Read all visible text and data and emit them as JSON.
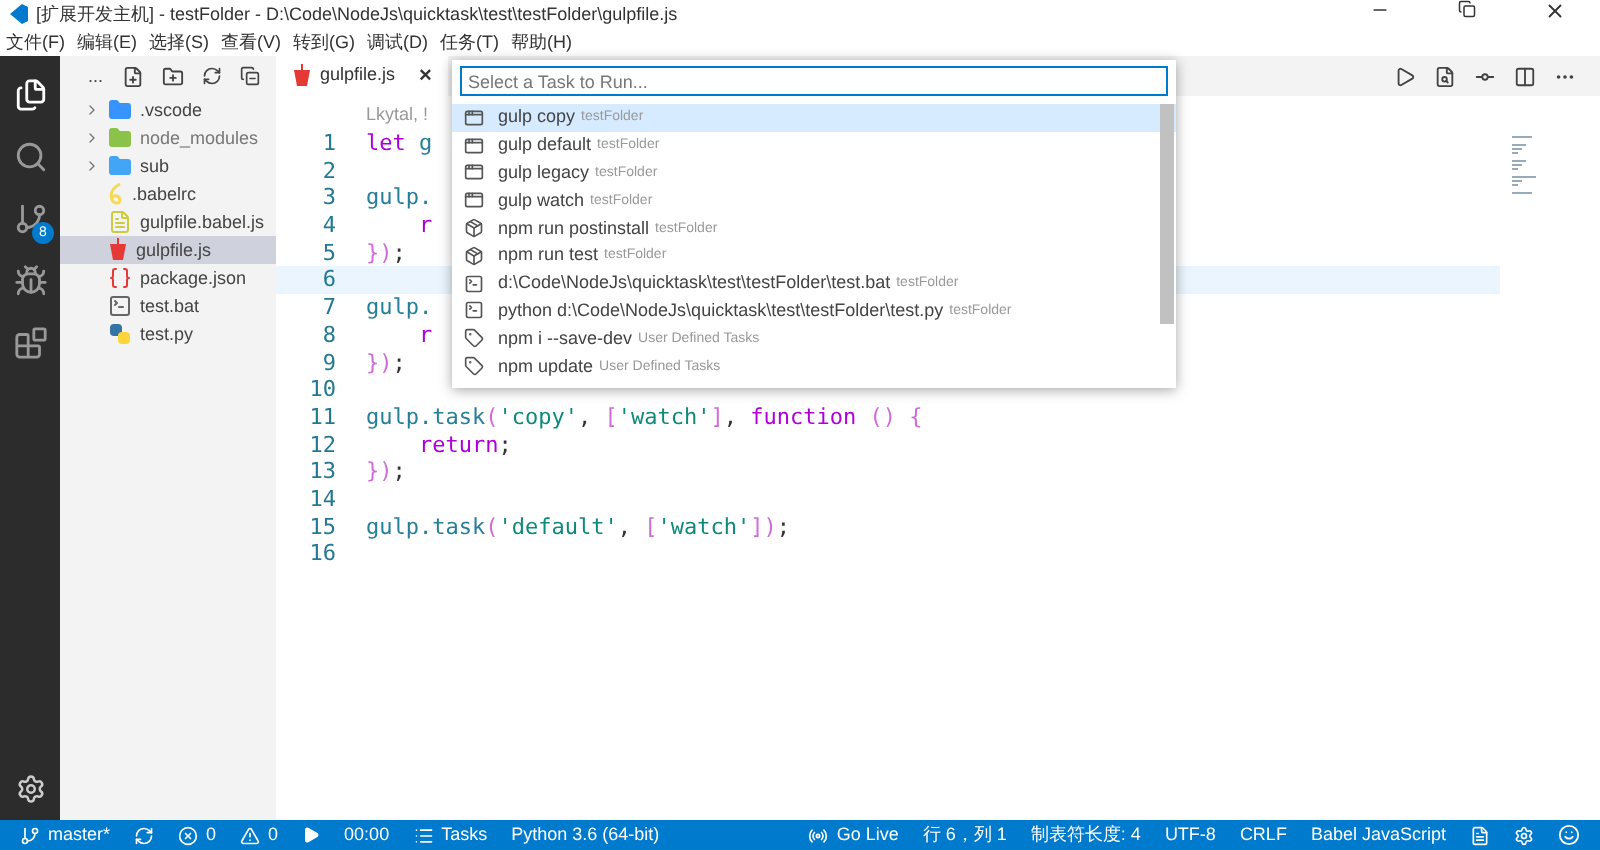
{
  "window": {
    "title": "[扩展开发主机] - testFolder - D:\\Code\\NodeJs\\quicktask\\test\\testFolder\\gulpfile.js"
  },
  "menu": [
    "文件(F)",
    "编辑(E)",
    "选择(S)",
    "查看(V)",
    "转到(G)",
    "调试(D)",
    "任务(T)",
    "帮助(H)"
  ],
  "activity_bar": [
    {
      "kind": "files",
      "selected": true
    },
    {
      "kind": "search",
      "selected": false
    },
    {
      "kind": "scm",
      "selected": false,
      "badge": "8"
    },
    {
      "kind": "debug",
      "selected": false
    },
    {
      "kind": "extensions",
      "selected": false
    }
  ],
  "explorer": {
    "more": "...",
    "items": [
      {
        "name": ".vscode",
        "kind": "folder-vscode",
        "expanded": false,
        "selected": false
      },
      {
        "name": "node_modules",
        "kind": "folder-node",
        "expanded": false,
        "selected": false
      },
      {
        "name": "sub",
        "kind": "folder",
        "expanded": false,
        "selected": false
      },
      {
        "name": ".babelrc",
        "kind": "babel",
        "selected": false
      },
      {
        "name": "gulpfile.babel.js",
        "kind": "js",
        "selected": false
      },
      {
        "name": "gulpfile.js",
        "kind": "gulp",
        "selected": true
      },
      {
        "name": "package.json",
        "kind": "json",
        "selected": false
      },
      {
        "name": "test.bat",
        "kind": "bat",
        "selected": false
      },
      {
        "name": "test.py",
        "kind": "py",
        "selected": false
      }
    ]
  },
  "tabs": [
    {
      "label": "gulpfile.js",
      "selected": true,
      "close": "×"
    }
  ],
  "editor": {
    "codelens": "Lkytal, !",
    "lines": [
      {
        "number": "1",
        "current": false,
        "tokens": [
          {
            "text": "let",
            "kind": "keyword"
          },
          {
            "text": " g",
            "kind": "plain"
          }
        ]
      },
      {
        "number": "2",
        "current": false
      },
      {
        "number": "3",
        "current": false,
        "tokens": [
          {
            "text": "gulp.",
            "kind": "plain"
          }
        ]
      },
      {
        "number": "4",
        "current": false,
        "tokens": [
          {
            "text": "    r",
            "kind": "keyword"
          }
        ]
      },
      {
        "number": "5",
        "current": false,
        "tokens": [
          {
            "text": "})",
            "kind": "bracket"
          },
          {
            "text": ";",
            "kind": "punct"
          }
        ]
      },
      {
        "number": "6",
        "current": true
      },
      {
        "number": "7",
        "current": false,
        "tokens": [
          {
            "text": "gulp.",
            "kind": "plain"
          }
        ]
      },
      {
        "number": "8",
        "current": false,
        "tokens": [
          {
            "text": "    r",
            "kind": "keyword"
          }
        ]
      },
      {
        "number": "9",
        "current": false,
        "tokens": [
          {
            "text": "})",
            "kind": "bracket"
          },
          {
            "text": ";",
            "kind": "punct"
          }
        ]
      },
      {
        "number": "10",
        "current": false
      },
      {
        "number": "11",
        "current": false,
        "tokens": [
          {
            "text": "gulp.",
            "kind": "plain"
          },
          {
            "text": "task",
            "kind": "func"
          },
          {
            "text": "(",
            "kind": "bracket"
          },
          {
            "text": "'copy'",
            "kind": "string"
          },
          {
            "text": ", ",
            "kind": "punct"
          },
          {
            "text": "[",
            "kind": "bracket"
          },
          {
            "text": "'watch'",
            "kind": "string"
          },
          {
            "text": "]",
            "kind": "bracket"
          },
          {
            "text": ", ",
            "kind": "punct"
          },
          {
            "text": "function",
            "kind": "keyword"
          },
          {
            "text": " () {",
            "kind": "bracket"
          }
        ]
      },
      {
        "number": "12",
        "current": false,
        "tokens": [
          {
            "text": "    return",
            "kind": "keyword"
          },
          {
            "text": ";",
            "kind": "punct"
          }
        ]
      },
      {
        "number": "13",
        "current": false,
        "tokens": [
          {
            "text": "})",
            "kind": "bracket"
          },
          {
            "text": ";",
            "kind": "punct"
          }
        ]
      },
      {
        "number": "14",
        "current": false
      },
      {
        "number": "15",
        "current": false,
        "tokens": [
          {
            "text": "gulp.",
            "kind": "plain"
          },
          {
            "text": "task",
            "kind": "func"
          },
          {
            "text": "(",
            "kind": "bracket"
          },
          {
            "text": "'default'",
            "kind": "string"
          },
          {
            "text": ", ",
            "kind": "punct"
          },
          {
            "text": "[",
            "kind": "bracket"
          },
          {
            "text": "'watch'",
            "kind": "string"
          },
          {
            "text": "])",
            "kind": "bracket"
          },
          {
            "text": ";",
            "kind": "punct"
          }
        ]
      },
      {
        "number": "16",
        "current": false
      }
    ]
  },
  "quick_pick": {
    "placeholder": "Select a Task to Run...",
    "items": [
      {
        "label": "gulp copy",
        "detail": "testFolder",
        "kind": "gulp",
        "selected": true
      },
      {
        "label": "gulp default",
        "detail": "testFolder",
        "kind": "gulp",
        "selected": false
      },
      {
        "label": "gulp legacy",
        "detail": "testFolder",
        "kind": "gulp",
        "selected": false
      },
      {
        "label": "gulp watch",
        "detail": "testFolder",
        "kind": "gulp",
        "selected": false
      },
      {
        "label": "npm run postinstall",
        "detail": "testFolder",
        "kind": "npm",
        "selected": false
      },
      {
        "label": "npm run test",
        "detail": "testFolder",
        "kind": "npm",
        "selected": false
      },
      {
        "label": "d:\\Code\\NodeJs\\quicktask\\test\\testFolder\\test.bat",
        "detail": "testFolder",
        "kind": "shell",
        "selected": false
      },
      {
        "label": "python d:\\Code\\NodeJs\\quicktask\\test\\testFolder\\test.py",
        "detail": "testFolder",
        "kind": "shell",
        "selected": false
      },
      {
        "label": "npm i --save-dev",
        "detail": "User Defined Tasks",
        "kind": "user",
        "selected": false
      },
      {
        "label": "npm update",
        "detail": "User Defined Tasks",
        "kind": "user",
        "selected": false
      }
    ]
  },
  "status_bar": {
    "left": [
      {
        "kind": "branch",
        "text": "master*"
      },
      {
        "kind": "sync"
      },
      {
        "kind": "errors",
        "text": "0"
      },
      {
        "kind": "warnings",
        "text": "0"
      },
      {
        "kind": "play"
      },
      {
        "kind": "plain",
        "text": "00:00"
      },
      {
        "kind": "tasks",
        "text": "Tasks"
      },
      {
        "kind": "plain",
        "text": "Python 3.6 (64-bit)"
      }
    ],
    "right": [
      {
        "kind": "live",
        "text": "Go Live"
      },
      {
        "kind": "plain",
        "text": "行 6，列 1"
      },
      {
        "kind": "plain",
        "text": "制表符长度: 4"
      },
      {
        "kind": "plain",
        "text": "UTF-8"
      },
      {
        "kind": "plain",
        "text": "CRLF"
      },
      {
        "kind": "plain",
        "text": "Babel JavaScript"
      },
      {
        "kind": "feedback-file"
      },
      {
        "kind": "gear"
      },
      {
        "kind": "smiley"
      }
    ]
  }
}
